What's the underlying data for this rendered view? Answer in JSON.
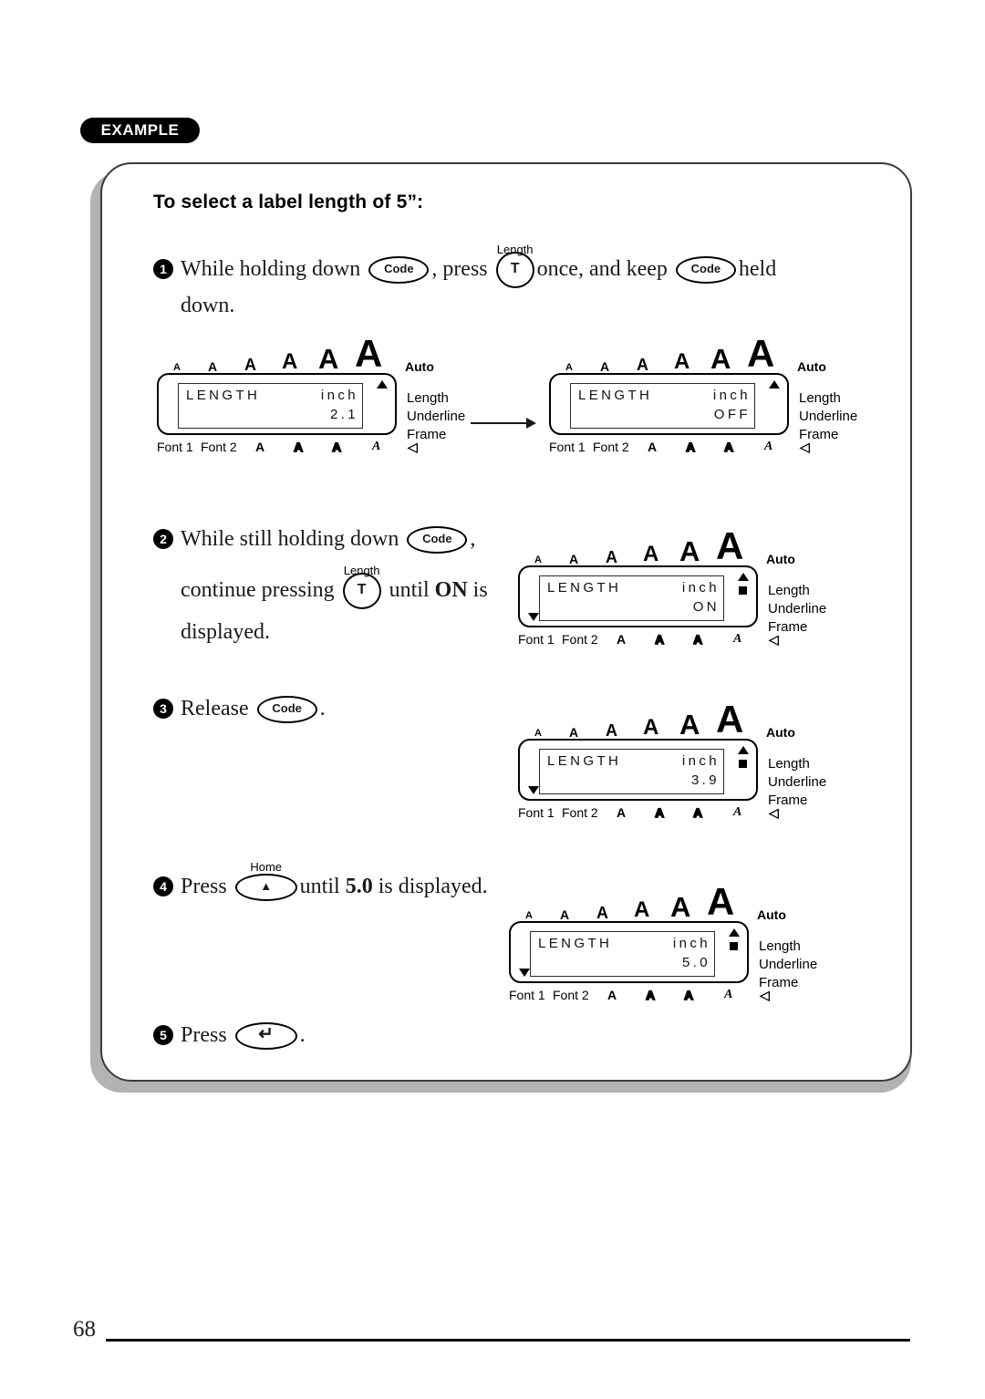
{
  "badge": {
    "label": "EXAMPLE"
  },
  "heading": "To select a label length of 5”:",
  "steps": [
    {
      "number": "1",
      "parts": [
        "While  holding  down",
        ",  press",
        "once,  and  keep",
        "held"
      ],
      "line2": "down.",
      "keys": [
        {
          "name": "code-key",
          "label": "Code",
          "top": ""
        },
        {
          "name": "t-key",
          "label": "T",
          "top": "Length"
        },
        {
          "name": "code-key",
          "label": "Code",
          "top": ""
        }
      ]
    },
    {
      "number": "2",
      "parts": [
        "While still holding down",
        ","
      ],
      "line2a": "continue pressing",
      "line2b": "until",
      "line2c": "ON",
      "line2d": "is",
      "line3": "displayed.",
      "keys": [
        {
          "name": "code-key",
          "label": "Code",
          "top": ""
        },
        {
          "name": "t-key",
          "label": "T",
          "top": "Length"
        }
      ]
    },
    {
      "number": "3",
      "parts": [
        "Release",
        "."
      ],
      "keys": [
        {
          "name": "code-key",
          "label": "Code",
          "top": ""
        }
      ]
    },
    {
      "number": "4",
      "parts": [
        "Press",
        "until",
        "5.0",
        "is displayed."
      ],
      "keys": [
        {
          "name": "home-key",
          "label": "▲",
          "top": "Home"
        }
      ]
    },
    {
      "number": "5",
      "parts": [
        "Press",
        "."
      ],
      "keys": [
        {
          "name": "return-key",
          "label": "↵",
          "top": ""
        }
      ]
    }
  ],
  "lcd_common": {
    "size_marks": [
      "A",
      "A",
      "A",
      "A",
      "A",
      "A"
    ],
    "auto_label": "Auto",
    "side_labels": [
      "Length",
      "Underline",
      "Frame"
    ],
    "bottom_labels": [
      "Font 1",
      "Font 2"
    ],
    "bottom_icons": [
      "A",
      "A",
      "A",
      "A",
      "◁"
    ],
    "line1_left": "LENGTH",
    "line1_right": "inch"
  },
  "displays": [
    {
      "name": "lcd-step1-before",
      "value": "2.1",
      "length_marker": false
    },
    {
      "name": "lcd-step1-after",
      "value": "OFF",
      "length_marker": false
    },
    {
      "name": "lcd-step2",
      "value": "ON",
      "length_marker": true
    },
    {
      "name": "lcd-step3",
      "value": "3.9",
      "length_marker": true
    },
    {
      "name": "lcd-step4",
      "value": "5.0",
      "length_marker": true
    }
  ],
  "footer": {
    "page_number": "68"
  }
}
